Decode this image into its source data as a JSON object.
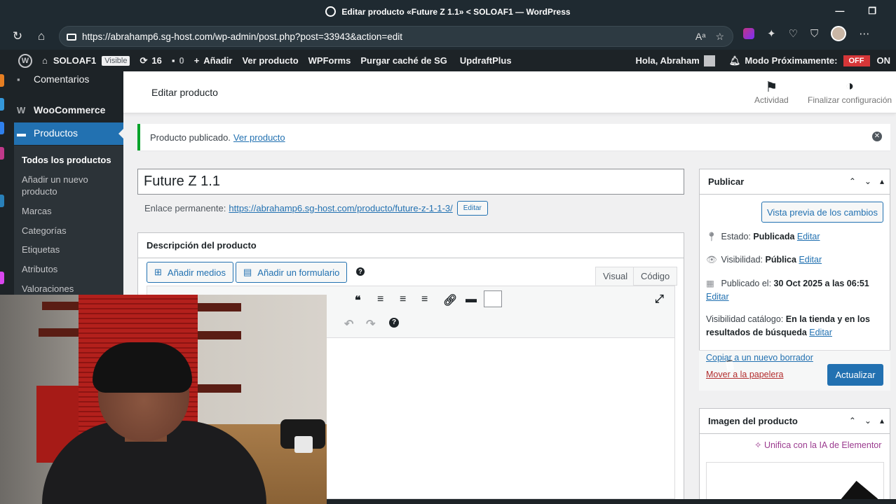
{
  "browser": {
    "window_title": "Editar producto «Future Z 1.1» < SOLOAF1 — WordPress",
    "url": "https://abrahamp6.sg-host.com/wp-admin/post.php?post=33943&action=edit"
  },
  "adminbar": {
    "site_name": "SOLOAF1",
    "visible_badge": "Visible",
    "updates_count": "16",
    "comments_count": "0",
    "add_new": "Añadir",
    "view_product": "Ver producto",
    "wpforms": "WPForms",
    "purge_cache": "Purgar caché de SG",
    "updraft": "UpdraftPlus",
    "greeting": "Hola, Abraham",
    "coming_soon": "Modo Próximamente:",
    "off": "OFF",
    "on": "ON"
  },
  "menu": {
    "comments": "Comentarios",
    "woocommerce": "WooCommerce",
    "products": "Productos",
    "sub": {
      "all": "Todos los productos",
      "add_new_1": "Añadir un nuevo",
      "add_new_2": "producto",
      "brands": "Marcas",
      "categories": "Categorías",
      "tags": "Etiquetas",
      "attributes": "Atributos",
      "reviews": "Valoraciones"
    }
  },
  "header": {
    "title": "Editar producto",
    "activity": "Actividad",
    "finish_setup": "Finalizar configuración"
  },
  "notice": {
    "text": "Producto publicado.",
    "link": "Ver producto"
  },
  "product": {
    "title": "Future Z 1.1",
    "permalink_label": "Enlace permanente:",
    "permalink_url": "https://abrahamp6.sg-host.com/producto/future-z-1-1-3/",
    "edit_slug": "Editar"
  },
  "editor": {
    "box_title": "Descripción del producto",
    "add_media": "Añadir medios",
    "add_form": "Añadir un formulario",
    "tab_visual": "Visual",
    "tab_code": "Código"
  },
  "publish": {
    "box_title": "Publicar",
    "preview": "Vista previa de los cambios",
    "status_label": "Estado:",
    "status_value": "Publicada",
    "visibility_label": "Visibilidad:",
    "visibility_value": "Pública",
    "published_label": "Publicado el:",
    "published_value": "30 Oct 2025 a las 06:51",
    "catalog_label": "Visibilidad catálogo:",
    "catalog_value_1": "En la tienda y en los",
    "catalog_value_2": "resultados de búsqueda",
    "edit": "Editar",
    "copy_draft": "Copiar a un nuevo borrador",
    "trash": "Mover a la papelera",
    "update": "Actualizar"
  },
  "image_box": {
    "title": "Imagen del producto",
    "elementor": "Unifica con la IA de Elementor"
  },
  "colors": {
    "wp_blue": "#2271b1",
    "admin_dark": "#1d2327",
    "success_green": "#00a32a",
    "danger_red": "#d63638"
  }
}
